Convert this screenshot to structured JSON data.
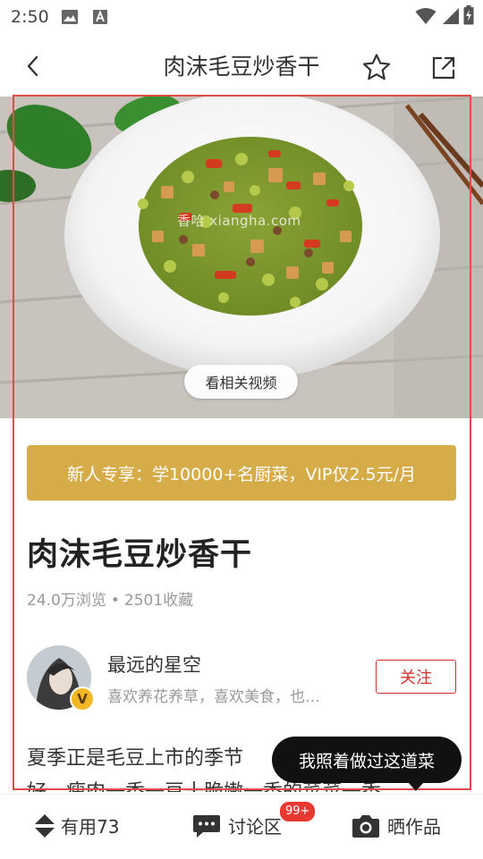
{
  "status_bar": {
    "time": "2:50"
  },
  "nav": {
    "title": "肉沫毛豆炒香干"
  },
  "hero": {
    "video_button": "看相关视频",
    "watermark": "香哈 xiangha.com"
  },
  "vip_banner": {
    "text": "新人专享：学10000+名厨菜，VIP仅2.5元/月"
  },
  "recipe": {
    "title": "肉沫毛豆炒香干",
    "views": "24.0万浏览",
    "separator": "•",
    "favorites": "2501收藏"
  },
  "author": {
    "name": "最远的星空",
    "description": "喜欢养花养草，喜欢美食，也…",
    "badge": "V",
    "follow_label": "关注"
  },
  "intro": {
    "line1": "夏季正是毛豆上市的季节",
    "line2_partial": "好，瘦肉一香一豆十脆嫩一香的菜菜一香"
  },
  "tooltip": {
    "text": "我照着做过这道菜"
  },
  "bottom_bar": {
    "useful": "有用73",
    "discussion": "讨论区",
    "discussion_badge": "99+",
    "show_work": "晒作品"
  },
  "colors": {
    "accent_red": "#d2322d",
    "vip_gold": "#d6ac48",
    "outline_red": "#e24a48"
  }
}
